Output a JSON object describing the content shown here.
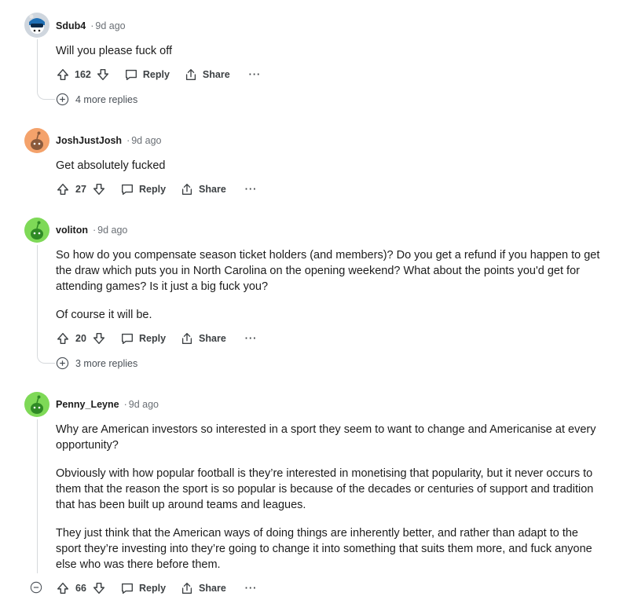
{
  "comments": [
    {
      "author": "Sdub4",
      "time": "9d ago",
      "paragraphs": [
        "Will you please fuck off"
      ],
      "score": "162",
      "more_replies": "4 more replies",
      "avatar_color": "#cfd6de"
    },
    {
      "author": "JoshJustJosh",
      "time": "9d ago",
      "paragraphs": [
        "Get absolutely fucked"
      ],
      "score": "27",
      "more_replies": "",
      "avatar_color": "#f4a26b"
    },
    {
      "author": "voliton",
      "time": "9d ago",
      "paragraphs": [
        "So how do you compensate season ticket holders (and members)? Do you get a refund if you happen to get the draw which puts you in North Carolina on the opening weekend? What about the points you'd get for attending games? Is it just a big fuck you?",
        "Of course it will be."
      ],
      "score": "20",
      "more_replies": "3 more replies",
      "avatar_color": "#7ed957"
    },
    {
      "author": "Penny_Leyne",
      "time": "9d ago",
      "paragraphs": [
        "Why are American investors so interested in a sport they seem to want to change and Americanise at every opportunity?",
        "Obviously with how popular football is they’re interested in monetising that popularity, but it never occurs to them that the reason the sport is so popular is because of the decades or centuries of support and tradition that has been built up around teams and leagues.",
        "They just think that the American ways of doing things are inherently better, and rather than adapt to the sport they’re investing into they’re going to change it into something that suits them more, and fuck anyone else who was there before them."
      ],
      "score": "66",
      "more_replies": "",
      "avatar_color": "#7ed957"
    }
  ],
  "actions": {
    "reply": "Reply",
    "share": "Share",
    "more": "···"
  },
  "dot": "·"
}
